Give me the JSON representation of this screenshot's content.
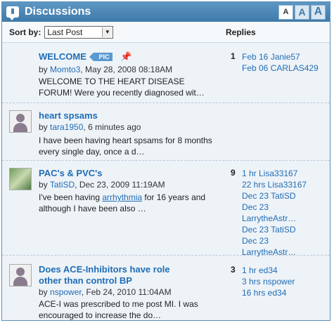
{
  "header": {
    "title": "Discussions",
    "text_sizes": [
      "A",
      "A",
      "A"
    ]
  },
  "toolbar": {
    "sort_label": "Sort by:",
    "sort_value": "Last Post",
    "replies_header": "Replies"
  },
  "icons": {
    "header": "speech-bubble-icon",
    "avatar_user": "user-silhouette-icon",
    "pin": "pushpin-icon",
    "dropdown": "chevron-down-icon"
  },
  "threads": [
    {
      "title": "WELCOME",
      "badge": "PIC",
      "pinned": true,
      "by": "by",
      "author": "Momto3",
      "date": ", May 28, 2008 08:18AM",
      "snippet": "WELCOME TO THE HEART DISEASE FORUM! Were you recently diagnosed wit…",
      "reply_count": "1",
      "replies": [
        "Feb 16 Janie57",
        "Feb 06 CARLAS429"
      ]
    },
    {
      "title": "heart spsams",
      "by": "by",
      "author": "tara1950",
      "date": ", 6 minutes ago",
      "snippet": "I have been having heart spsams for 8 months every single day, once a d…",
      "reply_count": "",
      "replies": []
    },
    {
      "title": "PAC's & PVC's",
      "by": "by",
      "author": "TatiSD",
      "date": ", Dec 23, 2009 11:19AM",
      "snippet_pre": "I've been having ",
      "snippet_link": "arrhythmia",
      "snippet_post": " for 16 years and although I have been also …",
      "reply_count": "9",
      "replies": [
        "1 hr Lisa33167",
        "22 hrs Lisa33167",
        "Dec 23 TatiSD",
        "Dec 23",
        "LarrytheAstr…",
        "Dec 23 TatiSD",
        "Dec 23",
        "LarrytheAstr…"
      ]
    },
    {
      "title_line1": "Does ACE-Inhibitors have role",
      "title_line2": "other than control BP",
      "by": "by",
      "author": "nspower",
      "date": ", Feb 24, 2010 11:04AM",
      "snippet": "ACE-I was prescribed to me post MI. I was encouraged to increase the do…",
      "reply_count": "3",
      "replies": [
        "1 hr ed34",
        "3 hrs nspower",
        "16 hrs ed34"
      ]
    }
  ]
}
